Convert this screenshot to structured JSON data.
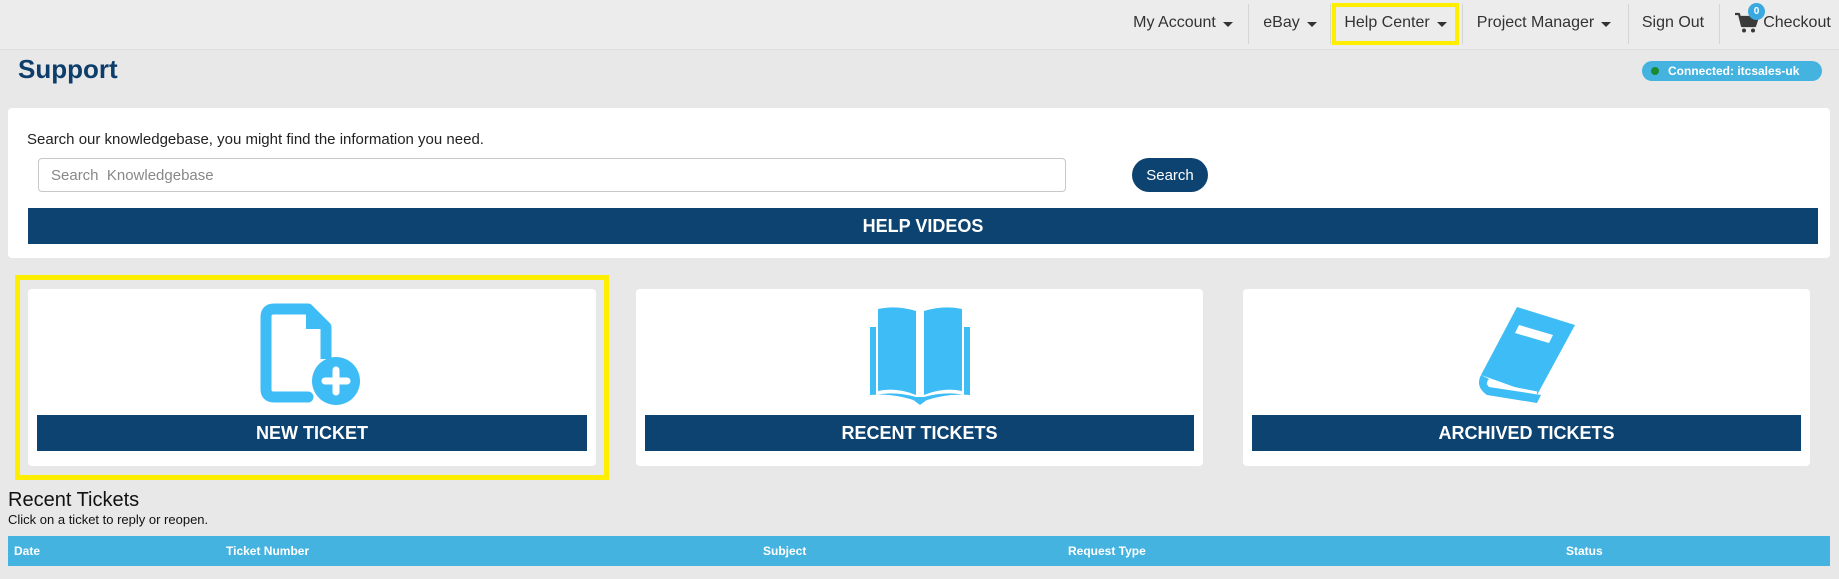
{
  "nav": {
    "my_account": "My Account",
    "ebay": "eBay",
    "help_center": "Help Center",
    "project_manager": "Project Manager",
    "sign_out": "Sign Out",
    "checkout": "Checkout",
    "cart_count": "0"
  },
  "header": {
    "title": "Support",
    "connection_status": "Connected: itcsales-uk"
  },
  "search": {
    "hint": "Search our knowledgebase, you might find the information you need.",
    "placeholder": "Search  Knowledgebase",
    "value": "",
    "button_label": "Search",
    "help_videos_label": "HELP VIDEOS"
  },
  "cards": [
    {
      "label": "NEW TICKET",
      "icon": "new-ticket-icon"
    },
    {
      "label": "RECENT TICKETS",
      "icon": "open-book-icon"
    },
    {
      "label": "ARCHIVED TICKETS",
      "icon": "closed-book-icon"
    }
  ],
  "recent": {
    "title": "Recent Tickets",
    "subtitle": "Click on a ticket to reply or reopen.",
    "columns": [
      "Date",
      "Ticket Number",
      "Subject",
      "Request Type",
      "Status"
    ]
  },
  "colors": {
    "navy": "#0d4371",
    "accent_blue": "#45b3e0",
    "icon_blue": "#3ebcf5",
    "highlight": "#ffee00"
  }
}
